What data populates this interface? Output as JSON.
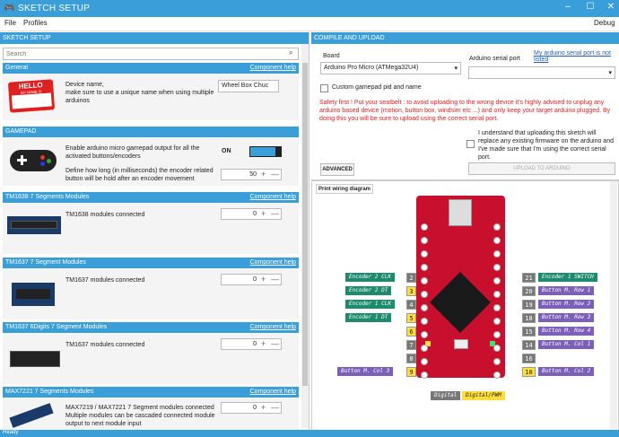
{
  "app": {
    "title": "SKETCH SETUP",
    "status": "Ready"
  },
  "menu": {
    "file": "File",
    "profiles": "Profiles",
    "debug": "Debug"
  },
  "left": {
    "header": "SKETCH SETUP",
    "search_placeholder": "Search",
    "help_label": "Component help",
    "general": {
      "title": "General",
      "desc": "Device name,\n make sure to use a unique name when using multiple arduinos",
      "device_name": "Wheel Box Chuc",
      "sticker_hello": "HELLO",
      "sticker_sub": "MY NAME IS"
    },
    "gamepad": {
      "title": "GAMEPAD",
      "desc1": "Enable arduino micro gamepad output for all the activated buttons/encoders",
      "toggle": "ON",
      "desc2": "Define how long (in milliseconds) the encoder related button will be hold after an encoder movement",
      "hold": "50"
    },
    "tm1638": {
      "title": "TM1638 7 Segments Modules",
      "desc": "TM1638 modules connected",
      "count": "0"
    },
    "tm1637": {
      "title": "TM1637 7 Segment Modules",
      "desc": "TM1637 modules connected",
      "count": "0"
    },
    "tm1637_6": {
      "title": "TM1637 6Digits 7 Segment Modules",
      "desc": "TM1637 modules connected",
      "count": "0"
    },
    "max7221": {
      "title": "MAX7221 7 Segments Modules",
      "desc": "MAX7219 / MAX7221 7 Segment modules connected\nMultiple modules can be cascaded connected module output to next module input",
      "count": "0"
    },
    "plus": "+",
    "minus": "—"
  },
  "right": {
    "header": "COMPILE AND UPLOAD",
    "board_label": "Board",
    "board_value": "Arduino Pro Micro (ATMega32U4)",
    "port_label": "Arduino serial port",
    "port_link": "My arduino serial port is not listed",
    "custom_pid": "Custom gamepad pid and name",
    "warning": "Safety first ! Put your seatbelt : to avoid uploading to the wrong device it's highly advised to unplug any arduino based device (motion, button box, windsim etc ...) and only keep your target arduino plugged. By doing this you will be sure to upload using the correct serial port.",
    "consent": "I understand that uploading this sketch will replace any existing firmware on the arduino and I've made sure that I'm using the correct serial port.",
    "advanced": "ADVANCED",
    "upload": "UPLOAD TO ARDUINO",
    "print_wiring": "Print wiring diagram",
    "legend_digital": "Digital",
    "legend_digital_pwm": "Digital/PWM",
    "board_pins_top": [
      "TXO",
      "RXI",
      "GND",
      "GND",
      "2",
      "3",
      "4",
      "5",
      "6",
      "7",
      "8",
      "9"
    ],
    "board_pins_right": [
      "RAW",
      "GND",
      "RST",
      "VCC",
      "A3",
      "A2",
      "A1",
      "A0",
      "15",
      "14",
      "16",
      "10"
    ],
    "left_labels": [
      "Encoder 2 CLK",
      "Encoder 2 DT",
      "Encoder 1 CLK",
      "Encoder 1 DT",
      "Button M. Col 3"
    ],
    "left_nums": [
      "2",
      "3",
      "4",
      "5",
      "6",
      "7",
      "8",
      "9"
    ],
    "right_labels": [
      "Encoder 1 SWITCH",
      "Button M. Row 1",
      "Button M. Row 2",
      "Button M. Row 3",
      "Button M. Row 4",
      "Button M. Col 1",
      "Button M. Col 2"
    ],
    "right_nums": [
      "21",
      "20",
      "19",
      "18",
      "15",
      "14",
      "16",
      "10"
    ]
  },
  "colors": {
    "accent": "#3a9fd8",
    "warning": "#e52020",
    "board": "#c8102e",
    "green_pin": "#1e8a6e",
    "yellow_pin": "#ffde3c",
    "purple_pin": "#7b5fb8"
  }
}
